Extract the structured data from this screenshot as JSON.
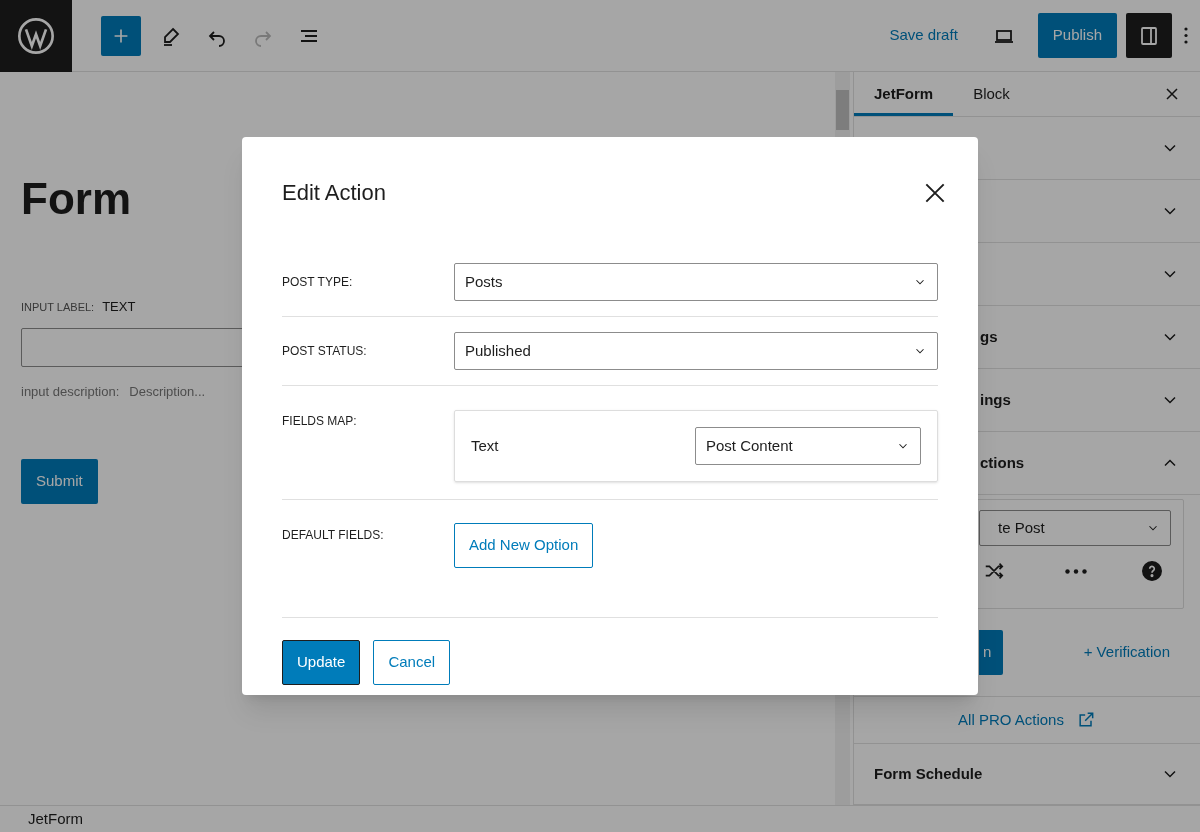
{
  "topbar": {
    "save_draft": "Save draft",
    "publish": "Publish"
  },
  "editor": {
    "title": "Form",
    "field_label": "INPUT LABEL:",
    "field_label_value": "TEXT",
    "description_label": "input description:",
    "description_value": "Description...",
    "submit": "Submit"
  },
  "sidebar": {
    "tabs": [
      {
        "label": "JetForm",
        "selected": true
      },
      {
        "label": "Block",
        "selected": false
      }
    ],
    "panels": [
      {
        "expanded": false
      },
      {
        "expanded": false
      },
      {
        "expanded": false
      },
      {
        "title": "gs",
        "expanded": false
      },
      {
        "title": "ings",
        "expanded": false
      },
      {
        "title": "ctions",
        "expanded": true
      }
    ],
    "action_select": "te Post",
    "action_button": "n",
    "verification_link": "+ Verification",
    "pro_link": "All PRO Actions",
    "bottom_panels": [
      {
        "title": "Form Schedule",
        "expanded": false
      }
    ]
  },
  "modal": {
    "title": "Edit Action",
    "rows": [
      {
        "kind": "select",
        "label": "POST TYPE:",
        "value": "Posts"
      },
      {
        "kind": "select",
        "label": "POST STATUS:",
        "value": "Published"
      },
      {
        "kind": "fields_map",
        "label": "FIELDS MAP:",
        "items": [
          {
            "field": "Text",
            "value": "Post Content"
          }
        ]
      },
      {
        "kind": "button",
        "label": "DEFAULT FIELDS:",
        "button": "Add New Option"
      }
    ],
    "buttons": [
      {
        "label": "Update",
        "kind": "primary"
      },
      {
        "label": "Cancel",
        "kind": "secondary"
      }
    ]
  },
  "status_bar": {
    "breadcrumb": "JetForm"
  }
}
